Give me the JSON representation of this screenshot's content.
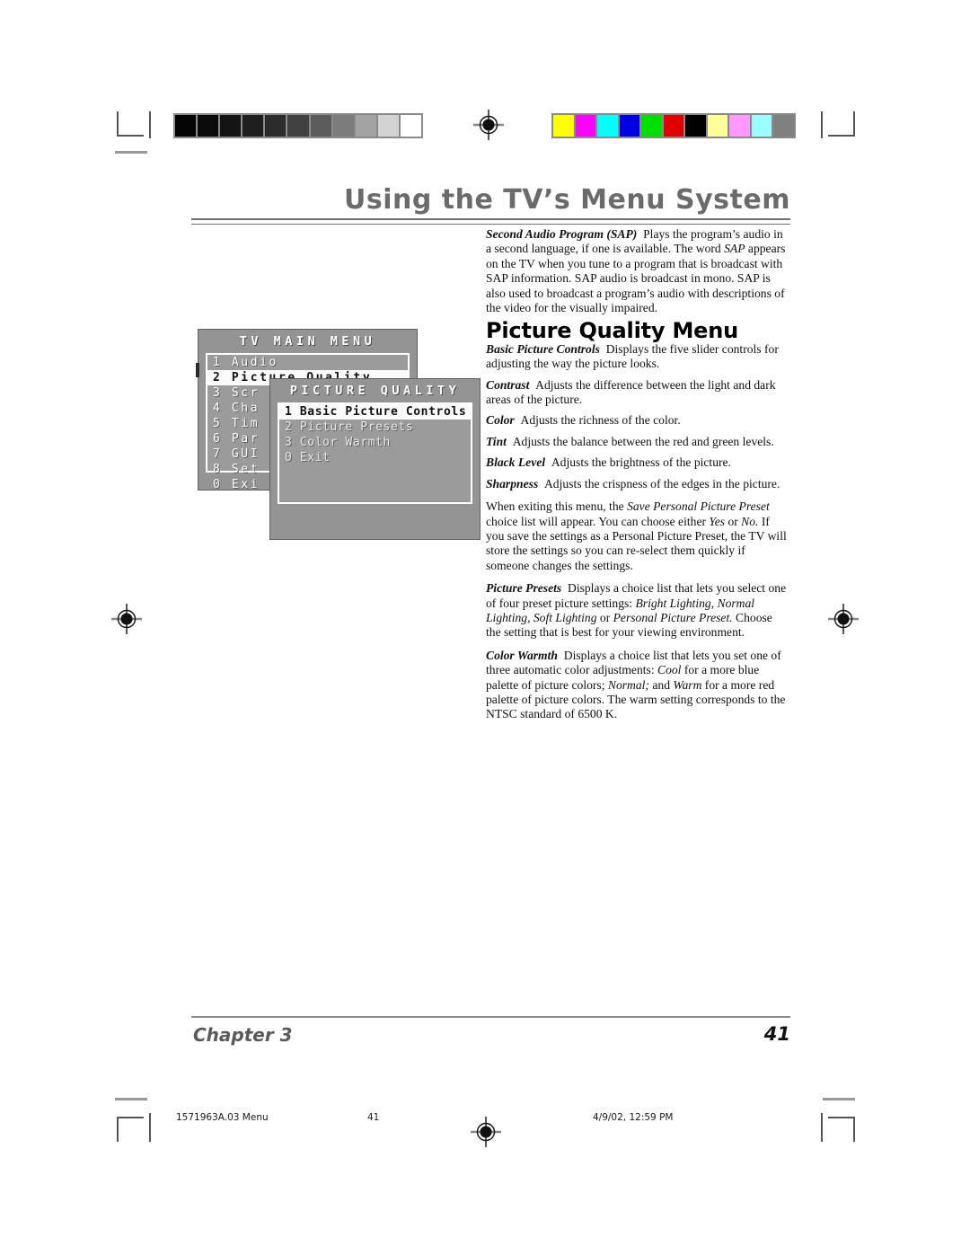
{
  "header": {
    "title": "Using the TV’s Menu System"
  },
  "printer_marks": {
    "grayscale_steps": [
      "#050505",
      "#0b0b0b",
      "#141414",
      "#1f1f1f",
      "#2c2c2c",
      "#414141",
      "#5c5c5c",
      "#7c7c7c",
      "#a3a3a3",
      "#d2d2d2",
      "#ffffff"
    ],
    "color_steps": [
      "#ffff00",
      "#ff00ff",
      "#00ffff",
      "#0000e0",
      "#00e000",
      "#e00000",
      "#000000",
      "#ffff99",
      "#ff99ff",
      "#99ffff",
      "#808080"
    ]
  },
  "tv_graphic": {
    "main_menu": {
      "title": "TV MAIN MENU",
      "items": [
        {
          "num": "1",
          "label": "Audio",
          "state": "normal"
        },
        {
          "num": "2",
          "label": "Picture Quality",
          "state": "selected"
        },
        {
          "num": "3",
          "label": "Scr",
          "state": "normal"
        },
        {
          "num": "4",
          "label": "Cha",
          "state": "normal"
        },
        {
          "num": "5",
          "label": "Tim",
          "state": "normal"
        },
        {
          "num": "6",
          "label": "Par",
          "state": "normal"
        },
        {
          "num": "7",
          "label": "GUI",
          "state": "normal"
        },
        {
          "num": "8",
          "label": "Set",
          "state": "normal"
        },
        {
          "num": "0",
          "label": "Exi",
          "state": "normal"
        }
      ]
    },
    "sub_menu": {
      "title": "PICTURE QUALITY",
      "items": [
        {
          "num": "1",
          "label": "Basic Picture Controls",
          "state": "selected"
        },
        {
          "num": "2",
          "label": "Picture Presets",
          "state": "dim"
        },
        {
          "num": "3",
          "label": "Color Warmth",
          "state": "dim"
        },
        {
          "num": "0",
          "label": "Exit",
          "state": "dim"
        }
      ]
    }
  },
  "body": {
    "sap_lead": "Second Audio Program (SAP)",
    "sap_text_1": "Plays the program’s audio in a second language, if one is available. The word ",
    "sap_italic_1": "SAP",
    "sap_text_2": " appears on the TV when you tune to a program that is broadcast with SAP information. SAP audio is broadcast in mono. SAP is also used to broadcast a program’s audio with descriptions of the video for the visually impaired.",
    "section_heading": "Picture Quality Menu",
    "bpc_lead": "Basic Picture Controls",
    "bpc_text": "Displays the five slider controls for adjusting the way the picture looks.",
    "contrast_lead": "Contrast",
    "contrast_text": "Adjusts the difference between the light and dark areas of the picture.",
    "color_lead": "Color",
    "color_text": "Adjusts the richness of the color.",
    "tint_lead": "Tint",
    "tint_text": "Adjusts the balance between the red and green levels.",
    "black_level_lead": "Black Level",
    "black_level_text": "Adjusts the brightness of the picture.",
    "sharpness_lead": "Sharpness",
    "sharpness_text": "Adjusts the crispness of the edges in the picture.",
    "exit_text_1": "When exiting this menu, the ",
    "exit_italic_1": "Save Personal Picture Preset",
    "exit_text_2": " choice list will appear. You can choose either ",
    "exit_italic_2": "Yes",
    "exit_text_3": " or ",
    "exit_italic_3": "No.",
    "exit_text_4": " If you save the settings as a Personal Picture Preset, the TV will store the settings so you can re-select them quickly if someone changes the settings.",
    "presets_lead": "Picture Presets",
    "presets_text_1": "Displays a choice list that lets you select one of four preset picture settings: ",
    "presets_italic_1": "Bright Lighting, Normal Lighting, Soft Lighting",
    "presets_text_2": " or ",
    "presets_italic_2": "Personal Picture Preset.",
    "presets_text_3": " Choose the setting that is best for your viewing environment.",
    "warmth_lead": "Color Warmth",
    "warmth_text_1": "Displays a choice list that lets you set one of three automatic color adjustments: ",
    "warmth_italic_1": "Cool",
    "warmth_text_2": " for a more blue palette of picture colors; ",
    "warmth_italic_2": "Normal;",
    "warmth_text_3": " and ",
    "warmth_italic_3": "Warm",
    "warmth_text_4": " for a more red palette of picture colors. The warm setting corresponds to the NTSC standard of 6500 K."
  },
  "page_footer": {
    "chapter": "Chapter 3",
    "page_number": "41"
  },
  "print_footer": {
    "document": "1571963A.03 Menu",
    "page": "41",
    "timestamp": "4/9/02, 12:59 PM"
  }
}
